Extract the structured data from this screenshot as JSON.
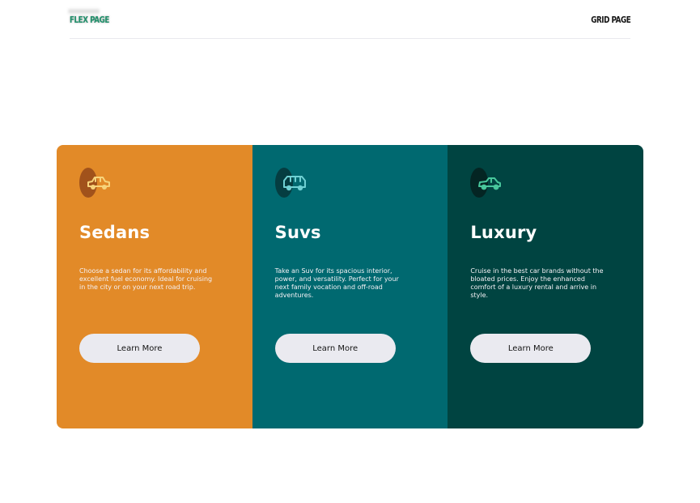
{
  "nav": {
    "flex_label": "Flex Page",
    "grid_label": "Grid Page"
  },
  "cards": [
    {
      "title": "Sedans",
      "description": "Choose a sedan for its affordability and excellent fuel economy. Ideal for cruising in the city or on your next road trip.",
      "button": "Learn More",
      "icon": "sedan-car-icon",
      "bg_color": "#e28a28",
      "blob_color": "#a1521b",
      "icon_color": "#f7d37a"
    },
    {
      "title": "Suvs",
      "description": "Take an Suv for its spacious interior, power, and versatility. Perfect for your next family vocation and off-road adventures.",
      "button": "Learn More",
      "icon": "suv-car-icon",
      "bg_color": "#006970",
      "blob_color": "#053d41",
      "icon_color": "#6fd0d3"
    },
    {
      "title": "Luxury",
      "description": "Cruise in the best car brands without the bloated prices. Enjoy the enhanced comfort of a luxury rental and arrive in style.",
      "button": "Learn More",
      "icon": "luxury-car-icon",
      "bg_color": "#004441",
      "blob_color": "#042523",
      "icon_color": "#48c79c"
    }
  ]
}
